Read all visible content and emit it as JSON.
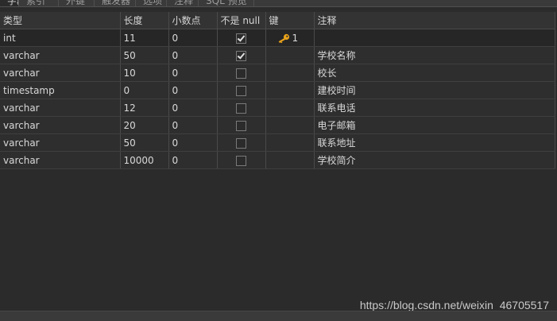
{
  "tabs": [
    "字段",
    "索引",
    "外键",
    "触发器",
    "选项",
    "注释",
    "SQL 预览"
  ],
  "columns": [
    "类型",
    "长度",
    "小数点",
    "不是 null",
    "键",
    "注释"
  ],
  "rows": [
    {
      "type": "int",
      "length": "11",
      "decimals": "0",
      "not_null": true,
      "key": "1",
      "comment": ""
    },
    {
      "type": "varchar",
      "length": "50",
      "decimals": "0",
      "not_null": true,
      "key": "",
      "comment": "学校名称"
    },
    {
      "type": "varchar",
      "length": "10",
      "decimals": "0",
      "not_null": false,
      "key": "",
      "comment": "校长"
    },
    {
      "type": "timestamp",
      "length": "0",
      "decimals": "0",
      "not_null": false,
      "key": "",
      "comment": "建校时间"
    },
    {
      "type": "varchar",
      "length": "12",
      "decimals": "0",
      "not_null": false,
      "key": "",
      "comment": "联系电话"
    },
    {
      "type": "varchar",
      "length": "20",
      "decimals": "0",
      "not_null": false,
      "key": "",
      "comment": "电子邮箱"
    },
    {
      "type": "varchar",
      "length": "50",
      "decimals": "0",
      "not_null": false,
      "key": "",
      "comment": "联系地址"
    },
    {
      "type": "varchar",
      "length": "10000",
      "decimals": "0",
      "not_null": false,
      "key": "",
      "comment": "学校简介"
    }
  ],
  "icons": {
    "key": "key-icon"
  },
  "watermark": "https://blog.csdn.net/weixin_46705517"
}
